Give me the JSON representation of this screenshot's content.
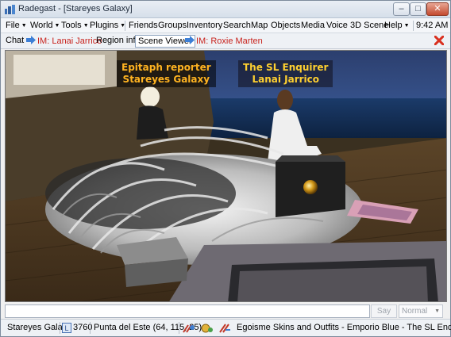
{
  "window": {
    "title": "Radegast - [Stareyes Galaxy]",
    "minimize": "–",
    "maximize": "□",
    "close": "✕"
  },
  "menu": {
    "file": "File",
    "world": "World",
    "tools": "Tools",
    "plugins": "Plugins",
    "friends": "Friends",
    "groups": "Groups",
    "inventory": "Inventory",
    "search": "Search",
    "map": "Map",
    "objects": "Objects",
    "media": "Media",
    "voice": "Voice",
    "scene": "3D Scene",
    "help": "Help",
    "clock": "9:42 AM"
  },
  "tabs": {
    "chat": "Chat",
    "im_lanai": "IM: Lanai Jarrico",
    "region_info": "Region info",
    "scene_viewer": "Scene Viewer",
    "im_roxie": "IM: Roxie Marten"
  },
  "scene": {
    "left_label_line1": "Epitaph reporter",
    "left_label_line2": "Stareyes Galaxy",
    "right_label_line1": "The SL Enquirer",
    "right_label_line2": "Lanai Jarrico"
  },
  "input": {
    "value": "",
    "say_label": "Say",
    "mode_value": "Normal"
  },
  "status": {
    "avatar_name": "Stareyes Galaxy",
    "balance": "3760",
    "location": "Punta del Este (64, 115, 25)",
    "parcel": "Egoisme Skins and Outfits - Emporio Blue - The SL Enquirer"
  },
  "colors": {
    "im_tab": "#c8221c",
    "label_left": "#ffb321",
    "label_right": "#ffd030"
  }
}
